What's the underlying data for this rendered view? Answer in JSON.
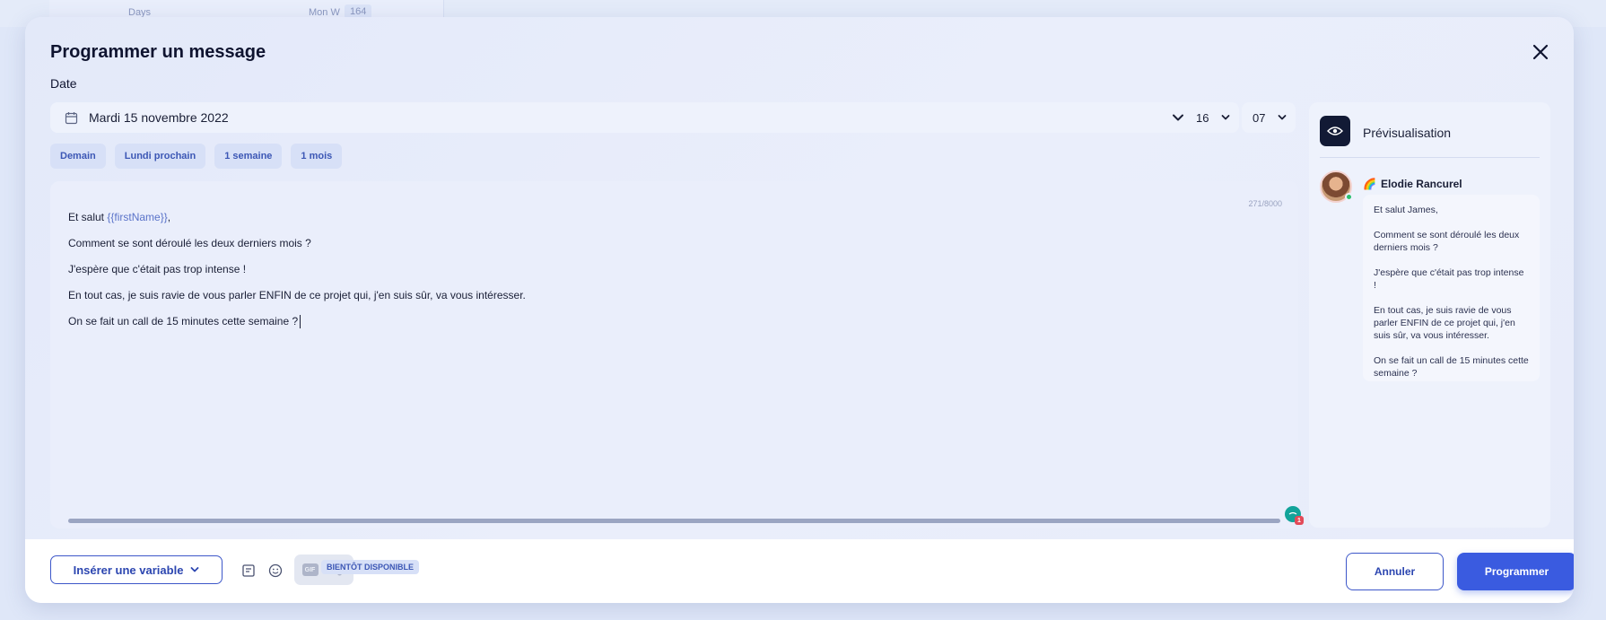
{
  "background": {
    "text_left": "Days",
    "text_right": "Mon W",
    "badge": "164"
  },
  "modal": {
    "title": "Programmer un message",
    "date_label": "Date",
    "date_value": "Mardi 15 novembre 2022",
    "hour_value": "16",
    "minute_value": "07",
    "quick_chips": [
      "Demain",
      "Lundi prochain",
      "1 semaine",
      "1 mois"
    ]
  },
  "editor": {
    "counter": "271/8000",
    "line1_prefix": "Et salut ",
    "line1_variable": "{{firstName}}",
    "line1_suffix": ",",
    "line2": "Comment se sont déroulé les deux derniers mois ?",
    "line3": "J'espère que c'était pas trop intense !",
    "line4": "En tout cas, je suis ravie de vous parler ENFIN de ce projet qui, j'en suis sûr, va vous intéresser.",
    "line5": "On se fait un call de 15 minutes cette semaine ?"
  },
  "preview": {
    "title": "Prévisualisation",
    "sender_emoji": "🌈",
    "sender_name": "Elodie Rancurel",
    "messages": [
      "Et salut James,",
      "Comment se sont déroulé les deux derniers mois ?",
      "J'espère que c'était pas trop intense !",
      "En tout cas, je suis ravie de vous parler ENFIN de ce projet qui, j'en suis sûr, va vous intéresser.",
      "On se fait un call de 15 minutes cette semaine ?"
    ]
  },
  "footer": {
    "insert_variable_label": "Insérer une variable",
    "gif_label": "GIF",
    "soon_label": "BIENTÔT DISPONIBLE",
    "cancel_label": "Annuler",
    "submit_label": "Programmer"
  },
  "colors": {
    "accent": "#3a5be0",
    "chip_text": "#3c57b5",
    "variable_text": "#5a73c9",
    "online": "#2bbf6d"
  }
}
